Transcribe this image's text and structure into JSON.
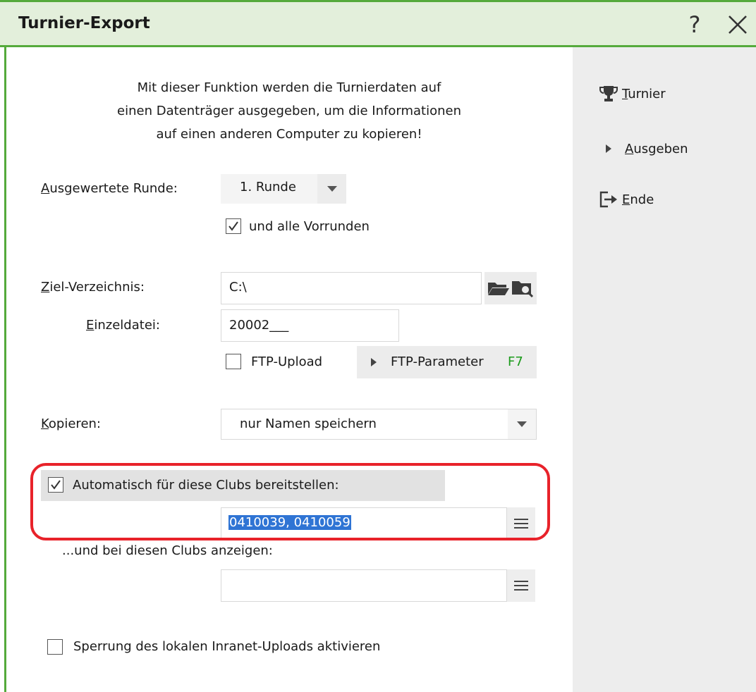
{
  "window": {
    "title": "Turnier-Export",
    "help_label": "?"
  },
  "intro": {
    "line1": "Mit dieser Funktion werden die Turnierdaten auf",
    "line2": "einen Datenträger ausgegeben, um die Informationen",
    "line3": "auf einen anderen Computer zu kopieren!"
  },
  "round": {
    "label_first": "A",
    "label_rest": "usgewertete Runde:",
    "value": "1. Runde",
    "all_prev_label": "und alle Vorrunden",
    "all_prev_checked": true
  },
  "target_dir": {
    "label_first": "Z",
    "label_rest": "iel-Verzeichnis:",
    "value": "C:\\"
  },
  "single_file": {
    "label_first": "E",
    "label_rest": "inzeldatei:",
    "value": "20002___"
  },
  "ftp": {
    "upload_label": "FTP-Upload",
    "upload_checked": false,
    "params_label": "FTP-Parameter",
    "params_shortcut": "F7"
  },
  "copy": {
    "label_first": "K",
    "label_rest": "opieren:",
    "value": "nur Namen speichern"
  },
  "auto_clubs": {
    "label": "Automatisch für diese Clubs bereitstellen:",
    "checked": true,
    "value": "0410039, 0410059"
  },
  "show_clubs": {
    "label": "...und bei diesen Clubs anzeigen:",
    "value": ""
  },
  "lock_upload": {
    "label": "Sperrung des lokalen Inranet-Uploads aktivieren",
    "checked": false
  },
  "sidebar": {
    "items": [
      {
        "first": "T",
        "rest": "urnier",
        "icon": "trophy-icon"
      },
      {
        "first": "A",
        "rest": "usgeben",
        "icon": "play-arrow-icon"
      },
      {
        "first": "E",
        "rest": "nde",
        "icon": "exit-icon"
      }
    ]
  },
  "colors": {
    "accent_green": "#55aa3c",
    "title_bg": "#e3efdb",
    "highlight_red": "#e8222a",
    "shortcut_green": "#1a9a1a",
    "selection_blue": "#2f74d4"
  }
}
